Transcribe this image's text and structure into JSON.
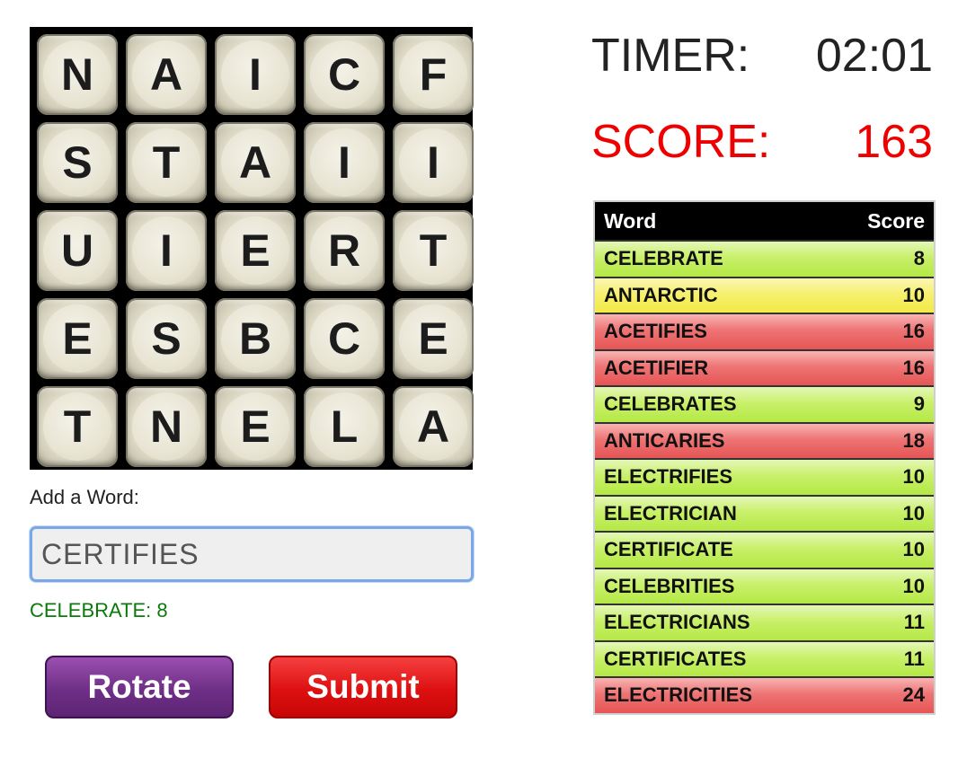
{
  "board": {
    "letters": [
      "N",
      "A",
      "I",
      "C",
      "F",
      "S",
      "T",
      "A",
      "I",
      "I",
      "U",
      "I",
      "E",
      "R",
      "T",
      "E",
      "S",
      "B",
      "C",
      "E",
      "T",
      "N",
      "E",
      "L",
      "A"
    ]
  },
  "add_word": {
    "label": "Add a Word:",
    "input_value": "CERTIFIES",
    "last_result": "CELEBRATE: 8"
  },
  "buttons": {
    "rotate": "Rotate",
    "submit": "Submit"
  },
  "timer": {
    "label": "TIMER:",
    "value": "02:01"
  },
  "score": {
    "label": "SCORE:",
    "value": "163"
  },
  "words_table": {
    "headers": {
      "word": "Word",
      "score": "Score"
    },
    "rows": [
      {
        "word": "CELEBRATE",
        "score": "8",
        "status": "green"
      },
      {
        "word": "ANTARCTIC",
        "score": "10",
        "status": "yellow"
      },
      {
        "word": "ACETIFIES",
        "score": "16",
        "status": "red"
      },
      {
        "word": "ACETIFIER",
        "score": "16",
        "status": "red"
      },
      {
        "word": "CELEBRATES",
        "score": "9",
        "status": "green"
      },
      {
        "word": "ANTICARIES",
        "score": "18",
        "status": "red"
      },
      {
        "word": "ELECTRIFIES",
        "score": "10",
        "status": "green"
      },
      {
        "word": "ELECTRICIAN",
        "score": "10",
        "status": "green"
      },
      {
        "word": "CERTIFICATE",
        "score": "10",
        "status": "green"
      },
      {
        "word": "CELEBRITIES",
        "score": "10",
        "status": "green"
      },
      {
        "word": "ELECTRICIANS",
        "score": "11",
        "status": "green"
      },
      {
        "word": "CERTIFICATES",
        "score": "11",
        "status": "green"
      },
      {
        "word": "ELECTRICITIES",
        "score": "24",
        "status": "red"
      }
    ]
  },
  "colors": {
    "score_red": "#ee0000",
    "valid_green": "#c9f06a",
    "partial_yellow": "#f6f070",
    "invalid_red": "#ee7474",
    "rotate_purple": "#6e2f86",
    "submit_red": "#dd1010"
  }
}
